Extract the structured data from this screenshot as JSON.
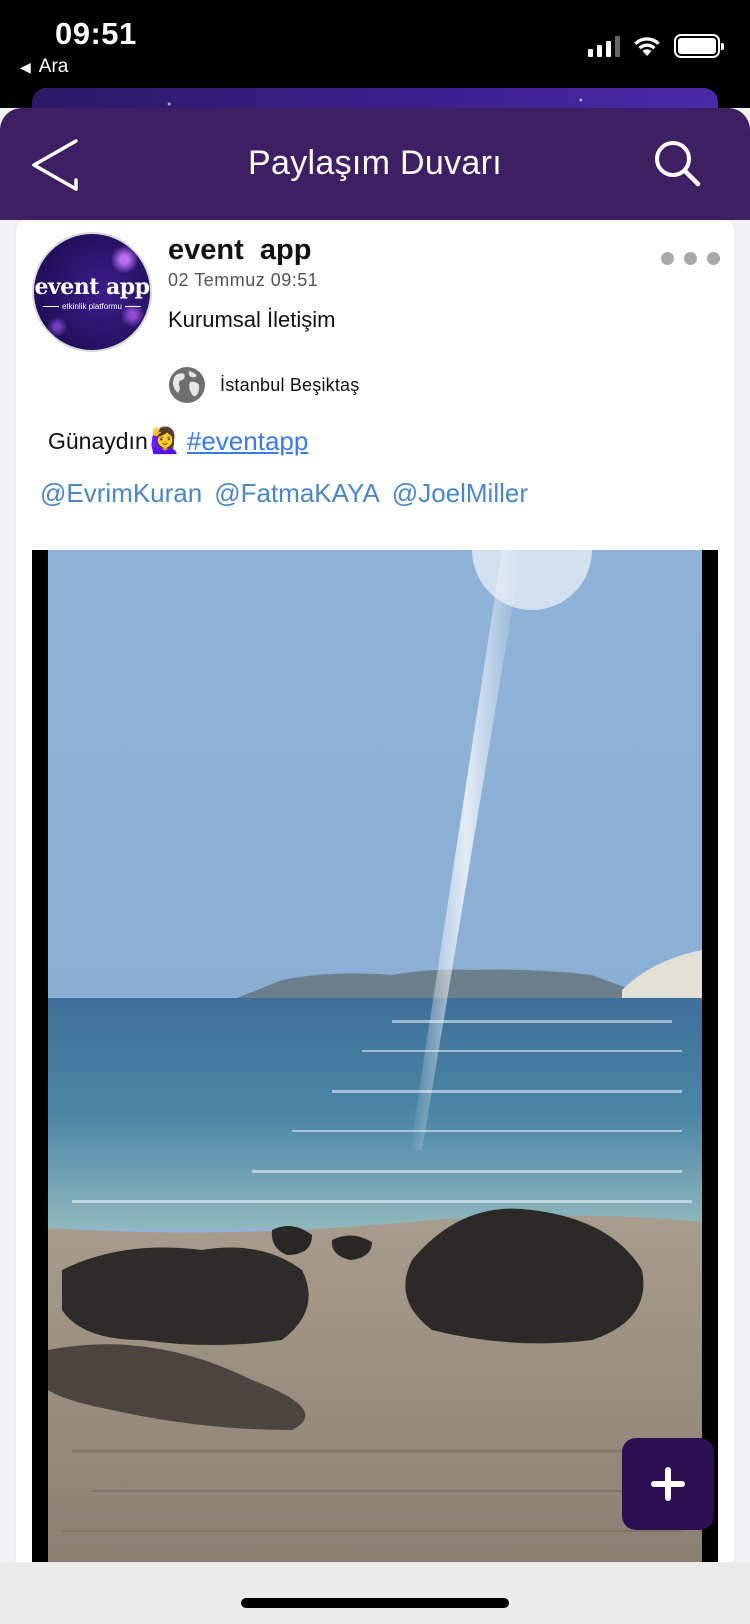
{
  "status_bar": {
    "time": "09:51",
    "back_app": "Ara",
    "back_glyph": "◀"
  },
  "header": {
    "title": "Paylaşım Duvarı",
    "back_icon": "back-triangle-icon",
    "search_icon": "search-icon"
  },
  "post": {
    "author": "event  app",
    "date": "02 Temmuz 09:51",
    "category": "Kurumsal İletişim",
    "location": "İstanbul Beşiktaş",
    "avatar_logo": "event app",
    "avatar_subtitle": "etkinlik platformu",
    "text": "Günaydın",
    "emoji": "🙋‍♀️",
    "hashtag": "#eventapp",
    "mentions": [
      "@EvrimKuran",
      "@FatmaKAYA",
      "@JoelMiller"
    ],
    "photo_description_icon": "beach-photo"
  },
  "fab": {
    "icon": "plus-icon"
  },
  "colors": {
    "header_bg": "#3e1f63",
    "fab_bg": "#2c0f52",
    "hashtag": "#3b7be8",
    "mention": "#4a87c4"
  }
}
